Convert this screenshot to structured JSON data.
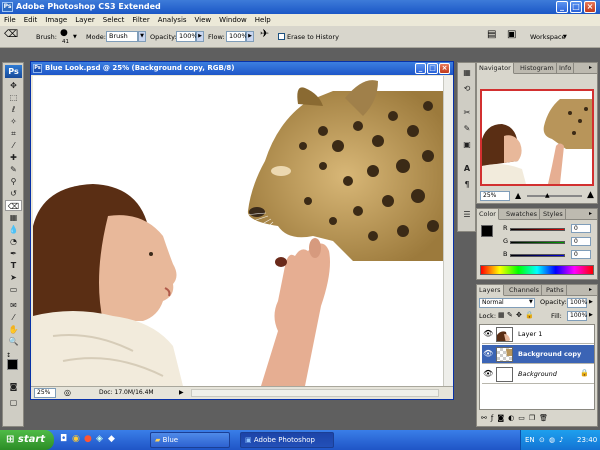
{
  "app": {
    "title": "Adobe Photoshop CS3 Extended",
    "logo": "Ps"
  },
  "menu": [
    "File",
    "Edit",
    "Image",
    "Layer",
    "Select",
    "Filter",
    "Analysis",
    "View",
    "Window",
    "Help"
  ],
  "options": {
    "brush_label": "Brush:",
    "brush_size": "41",
    "mode_label": "Mode:",
    "mode_value": "Brush",
    "opacity_label": "Opacity:",
    "opacity_value": "100%",
    "flow_label": "Flow:",
    "flow_value": "100%",
    "erase_history": "Erase to History",
    "workspace": "Workspace"
  },
  "document": {
    "title": "Blue Look.psd @ 25% (Background copy, RGB/8)",
    "zoom": "25%",
    "doc_size": "Doc: 17.0M/16.4M"
  },
  "navigator": {
    "tabs": [
      "Navigator",
      "Histogram",
      "Info"
    ],
    "zoom": "25%"
  },
  "color": {
    "tabs": [
      "Color",
      "Swatches",
      "Styles"
    ],
    "channels": [
      {
        "label": "R",
        "value": "0",
        "color": "#e00000"
      },
      {
        "label": "G",
        "value": "0",
        "color": "#00a000"
      },
      {
        "label": "B",
        "value": "0",
        "color": "#0000e0"
      }
    ]
  },
  "layers": {
    "tabs": [
      "Layers",
      "Channels",
      "Paths"
    ],
    "blend_mode": "Normal",
    "opacity_label": "Opacity:",
    "opacity_value": "100%",
    "lock_label": "Lock:",
    "fill_label": "Fill:",
    "fill_value": "100%",
    "items": [
      {
        "name": "Layer 1",
        "selected": false
      },
      {
        "name": "Background copy",
        "selected": true
      },
      {
        "name": "Background",
        "selected": false,
        "locked": true
      }
    ]
  },
  "taskbar": {
    "start": "start",
    "buttons": [
      {
        "label": "Blue",
        "icon": "folder-icon"
      },
      {
        "label": "Adobe Photoshop CS...",
        "icon": "photoshop-icon",
        "active": true
      }
    ],
    "language": "EN",
    "time": "23:40"
  }
}
